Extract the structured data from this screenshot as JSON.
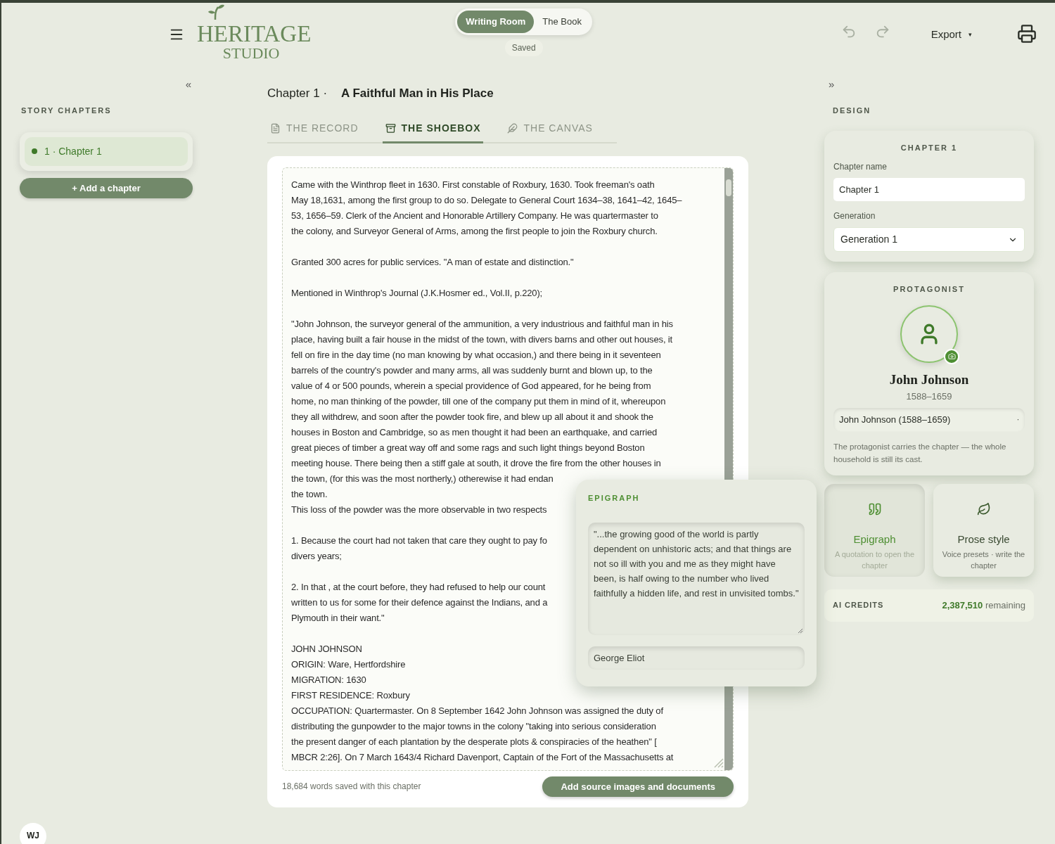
{
  "logo": {
    "title": "HERITAGE",
    "subtitle": "STUDIO"
  },
  "modes": [
    {
      "label": "Writing Room",
      "selected": true
    },
    {
      "label": "The Book",
      "selected": false
    }
  ],
  "save_status": "Saved",
  "export": {
    "label": "Export",
    "caret": "▾"
  },
  "sidebar": {
    "collapse": "«",
    "heading": "STORY CHAPTERS",
    "chapters": [
      {
        "label": "1 · Chapter 1",
        "selected": true,
        "color": "#3f7a2a"
      }
    ],
    "add_button": "+ Add a chapter"
  },
  "chapter": {
    "number": "Chapter 1 ·",
    "title": "A Faithful Man in His Place"
  },
  "tabs": [
    {
      "label": "THE RECORD",
      "kind": "record",
      "selected": false
    },
    {
      "label": "THE SHOEBOX",
      "kind": "shoebox",
      "selected": true
    },
    {
      "label": "THE CANVAS",
      "kind": "canvas",
      "selected": false
    }
  ],
  "shoebox": {
    "paragraphs": [
      [
        "Came with the Winthrop fleet in 1630. First constable of Roxbury, 1630. Took freeman's oath",
        "May 18,1631, among the first group to do so. Delegate to General Court 1634–38, 1641–42, 1645–",
        "53, 1656–59. Clerk of the Ancient and Honorable Artillery Company. He was quartermaster to",
        "the colony, and Surveyor General of Arms, among the first people to join the Roxbury church."
      ],
      [
        "Granted 300 acres for public services. \"A man of estate and distinction.\""
      ],
      [
        "Mentioned in Winthrop's Journal (J.K.Hosmer ed., Vol.II, p.220);"
      ],
      [
        "\"John Johnson, the surveyor general of the ammunition, a very industrious and faithful man in his",
        "place, having built a fair house in the midst of the town, with divers barns and other out houses, it",
        "fell on fire in the day time (no man knowing by what occasion,) and there being in it seventeen",
        "barrels of the country's powder and many arms, all was suddenly burnt and blown up, to the",
        "value of 4 or 500 pounds, wherein a special providence of God appeared, for he being from",
        "home, no man thinking of the powder, till one of the company put them in mind of it, whereupon",
        "they all withdrew, and soon after the powder took fire, and blew up all about it and shook the",
        "houses in Boston and Cambridge, so as men thought it had been an earthquake, and carried",
        "great pieces of timber a great way off and some rags and such light things beyond Boston",
        "meeting house. There being then a stiff gale at south, it drove the fire from the other houses in",
        "the town, (for this was the most northerly,) otherewise it had endan",
        "the town.",
        "This loss of the powder was the more observable in two respects"
      ],
      [
        "1. Because the court had not taken that care they ought to pay fo",
        "divers years;"
      ],
      [
        "2. In that , at the court before, they had refused to help our count",
        "written to us for some for their defence against the Indians, and a",
        "Plymouth in their want.\""
      ],
      [
        "JOHN JOHNSON",
        "ORIGIN: Ware, Hertfordshire",
        "MIGRATION: 1630",
        "FIRST RESIDENCE: Roxbury",
        "OCCUPATION: Quartermaster. On 8 September 1642 John Johnson was assigned the duty of",
        "distributing the gunpowder to the major towns in the colony \"taking into serious consideration",
        "the present danger of each plantation by the desperate plots & conspiracies of the heathen\" [",
        "MBCR 2:26]. On 7 March 1643/4 Richard Davenport, Captain of the Fort of the Massachusetts at"
      ]
    ],
    "word_count": "18,684 words saved with this chapter",
    "add_button": "Add source images and documents"
  },
  "epigraph_popover": {
    "heading": "EPIGRAPH",
    "quote": "\"...the growing good of the world is partly dependent on unhistoric acts; and that things are not so ill with you and me as they might have been, is half owing to the number who lived faithfully a hidden life, and rest in unvisited tombs.\"",
    "author": "George Eliot"
  },
  "design": {
    "expand": "»",
    "heading": "DESIGN",
    "chapter_card": {
      "heading": "CHAPTER 1",
      "name_label": "Chapter name",
      "name_value": "Chapter 1",
      "generation_label": "Generation",
      "generation_value": "Generation 1"
    },
    "protagonist": {
      "heading": "PROTAGONIST",
      "name": "John Johnson",
      "dates": "1588–1659",
      "select_value": "John Johnson (1588–1659)",
      "caret": "·",
      "note": "The protagonist carries the chapter — the whole household is still its cast."
    },
    "tools": [
      {
        "kind": "epigraph",
        "title": "Epigraph",
        "subtitle": "A quotation to open the chapter",
        "selected": true
      },
      {
        "kind": "prose",
        "title": "Prose style",
        "subtitle": "Voice presets · write the chapter",
        "selected": false
      }
    ],
    "credits": {
      "label": "AI CREDITS",
      "amount": "2,387,510",
      "suffix": "remaining"
    }
  },
  "user": {
    "initials": "WJ"
  }
}
